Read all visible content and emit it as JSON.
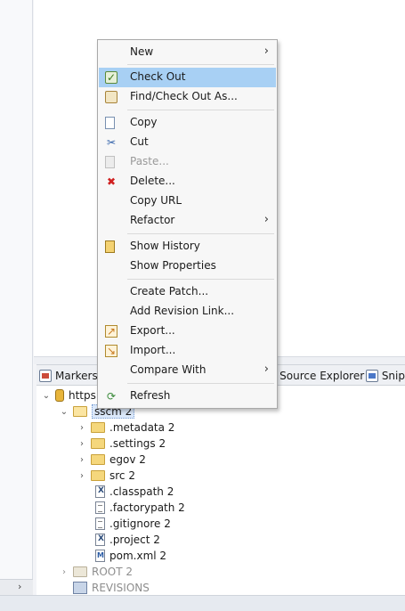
{
  "context_menu": {
    "items": [
      {
        "label": "New",
        "icon": "none",
        "submenu": "›"
      },
      {
        "label": "Check Out",
        "icon": "checkout-icon"
      },
      {
        "label": "Find/Check Out As...",
        "icon": "find-checkout-icon"
      },
      {
        "label": "Copy",
        "icon": "copy-icon"
      },
      {
        "label": "Cut",
        "icon": "cut-icon"
      },
      {
        "label": "Paste...",
        "icon": "paste-icon",
        "disabled": true
      },
      {
        "label": "Delete...",
        "icon": "delete-icon"
      },
      {
        "label": "Copy URL",
        "icon": "none"
      },
      {
        "label": "Refactor",
        "icon": "none",
        "submenu": "›"
      },
      {
        "label": "Show History",
        "icon": "history-icon"
      },
      {
        "label": "Show Properties",
        "icon": "none"
      },
      {
        "label": "Create Patch...",
        "icon": "none"
      },
      {
        "label": "Add Revision Link...",
        "icon": "none"
      },
      {
        "label": "Export...",
        "icon": "export-icon"
      },
      {
        "label": "Import...",
        "icon": "import-icon"
      },
      {
        "label": "Compare With",
        "icon": "none",
        "submenu": "›"
      },
      {
        "label": "Refresh",
        "icon": "refresh-icon"
      }
    ]
  },
  "views": {
    "markers_tab": "Markers",
    "source_explorer_tab": "a Source Explorer",
    "snippets_tab": "Snip"
  },
  "tree": {
    "repo_label": "https",
    "items": [
      {
        "label": "sscm 2"
      },
      {
        "label": ".metadata 2"
      },
      {
        "label": ".settings 2"
      },
      {
        "label": "egov 2"
      },
      {
        "label": "src 2"
      },
      {
        "label": ".classpath 2"
      },
      {
        "label": ".factorypath 2"
      },
      {
        "label": ".gitignore 2"
      },
      {
        "label": ".project 2"
      },
      {
        "label": "pom.xml 2"
      },
      {
        "label": "ROOT 2"
      },
      {
        "label": "REVISIONS"
      }
    ],
    "expand_glyph": "⌄",
    "collapse_glyph": "›"
  },
  "colors": {
    "menu_highlight": "#a8d0f4",
    "selection": "#dbe8fa"
  }
}
